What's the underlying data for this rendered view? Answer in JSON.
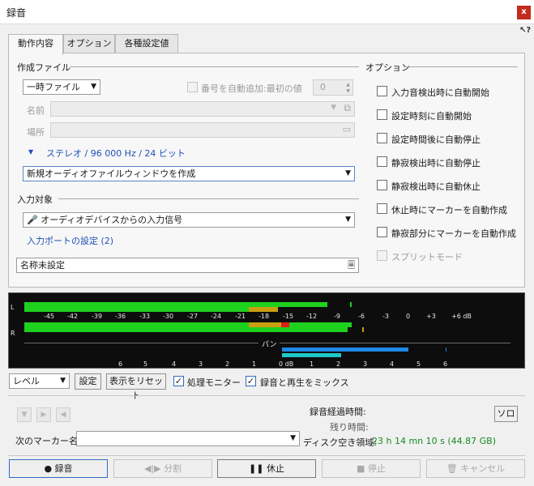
{
  "window": {
    "title": "録音",
    "close_label": "x",
    "help_label": "?"
  },
  "tabs": [
    {
      "label": "動作内容",
      "active": true
    },
    {
      "label": "オプション",
      "active": false
    },
    {
      "label": "各種設定値",
      "active": false
    }
  ],
  "file_section": {
    "heading": "作成ファイル",
    "file_type": "一時ファイル",
    "auto_number_label": "番号を自動追加:最初の値",
    "auto_number_value": "0",
    "name_label": "名前",
    "location_label": "場所",
    "format_text": "ステレオ / 96 000 Hz / 24 ビット",
    "window_option": "新規オーディオファイルウィンドウを作成"
  },
  "input_section": {
    "heading": "入力対象",
    "source": "オーディオデバイスからの入力信号",
    "ports_link": "入力ポートの設定 (2)",
    "track_name": "名称未設定"
  },
  "options_section": {
    "heading": "オプション",
    "items": [
      {
        "label": "入力音検出時に自動開始",
        "checked": false,
        "enabled": true
      },
      {
        "label": "設定時刻に自動開始",
        "checked": false,
        "enabled": true
      },
      {
        "label": "設定時間後に自動停止",
        "checked": false,
        "enabled": true
      },
      {
        "label": "静寂検出時に自動停止",
        "checked": false,
        "enabled": true
      },
      {
        "label": "静寂検出時に自動休止",
        "checked": false,
        "enabled": true
      },
      {
        "label": "休止時にマーカーを自動作成",
        "checked": false,
        "enabled": true
      },
      {
        "label": "静寂部分にマーカーを自動作成",
        "checked": false,
        "enabled": true
      },
      {
        "label": "スプリットモード",
        "checked": false,
        "enabled": false
      }
    ]
  },
  "meter": {
    "channel_left": "L",
    "channel_right": "R",
    "level_scale": [
      "-45",
      "-42",
      "-39",
      "-36",
      "-33",
      "-30",
      "-27",
      "-24",
      "-21",
      "-18",
      "-15",
      "-12",
      "-9",
      "-6",
      "-3",
      "0",
      "+3",
      "+6 dB"
    ],
    "pan_label": "パン",
    "pan_scale": [
      "6",
      "5",
      "4",
      "3",
      "2",
      "1",
      "0 dB",
      "1",
      "2",
      "3",
      "4",
      "5",
      "6"
    ],
    "colors": {
      "level": "#1fd11f",
      "peak_hold": "#c9a010",
      "clip": "#e01c1c",
      "pan_left": "#1e88e5",
      "pan_right": "#1ec8c8"
    }
  },
  "meter_controls": {
    "mode": "レベル",
    "settings_button": "設定",
    "reset_button": "表示をリセット",
    "monitor_label": "処理モニター",
    "monitor_checked": true,
    "mix_label": "録音と再生をミックス",
    "mix_checked": true
  },
  "status": {
    "elapsed_label": "録音経過時間:",
    "remaining_label": "残り時間:",
    "disk_label": "ディスク空き領域:",
    "disk_value": "23 h 14 mn 10 s (44.87 GB)",
    "solo_button": "ソロ",
    "next_marker_label": "次のマーカー名"
  },
  "actions": {
    "record": "録音",
    "split": "分割",
    "pause": "休止",
    "stop": "停止",
    "cancel": "キャンセル"
  }
}
